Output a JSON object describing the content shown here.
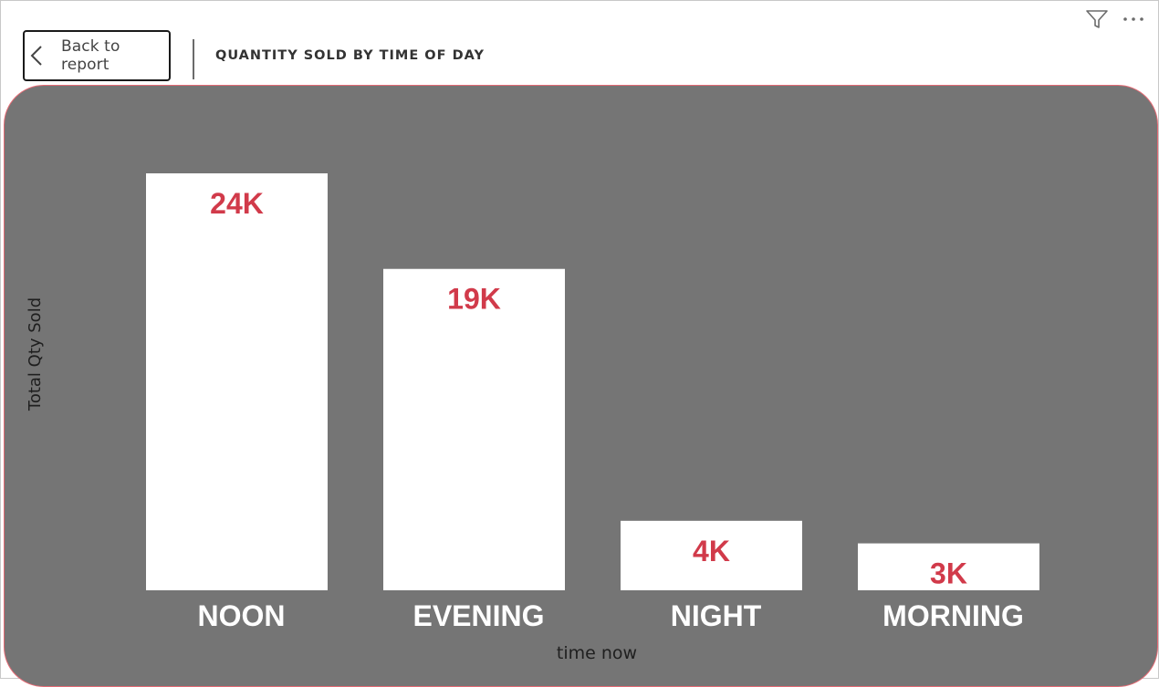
{
  "header": {
    "back_label": "Back to report",
    "title": "QUANTITY SOLD BY TIME OF DAY"
  },
  "icons": {
    "back": "chevron-left-icon",
    "filter": "filter-icon",
    "more": "more-options-icon"
  },
  "colors": {
    "panel_background": "#757575",
    "bar": "#ffffff",
    "value_label": "#d13a4a",
    "category_label": "#ffffff"
  },
  "chart_data": {
    "type": "bar",
    "title": "QUANTITY SOLD BY TIME OF DAY",
    "xlabel": "time now",
    "ylabel": "Total Qty Sold",
    "categories": [
      "NOON",
      "EVENING",
      "NIGHT",
      "MORNING"
    ],
    "values": [
      24000,
      18500,
      4000,
      2700
    ],
    "data_labels": [
      "24K",
      "19K",
      "4K",
      "3K"
    ],
    "ylim": [
      0,
      24000
    ],
    "grid": false,
    "legend": "none"
  }
}
